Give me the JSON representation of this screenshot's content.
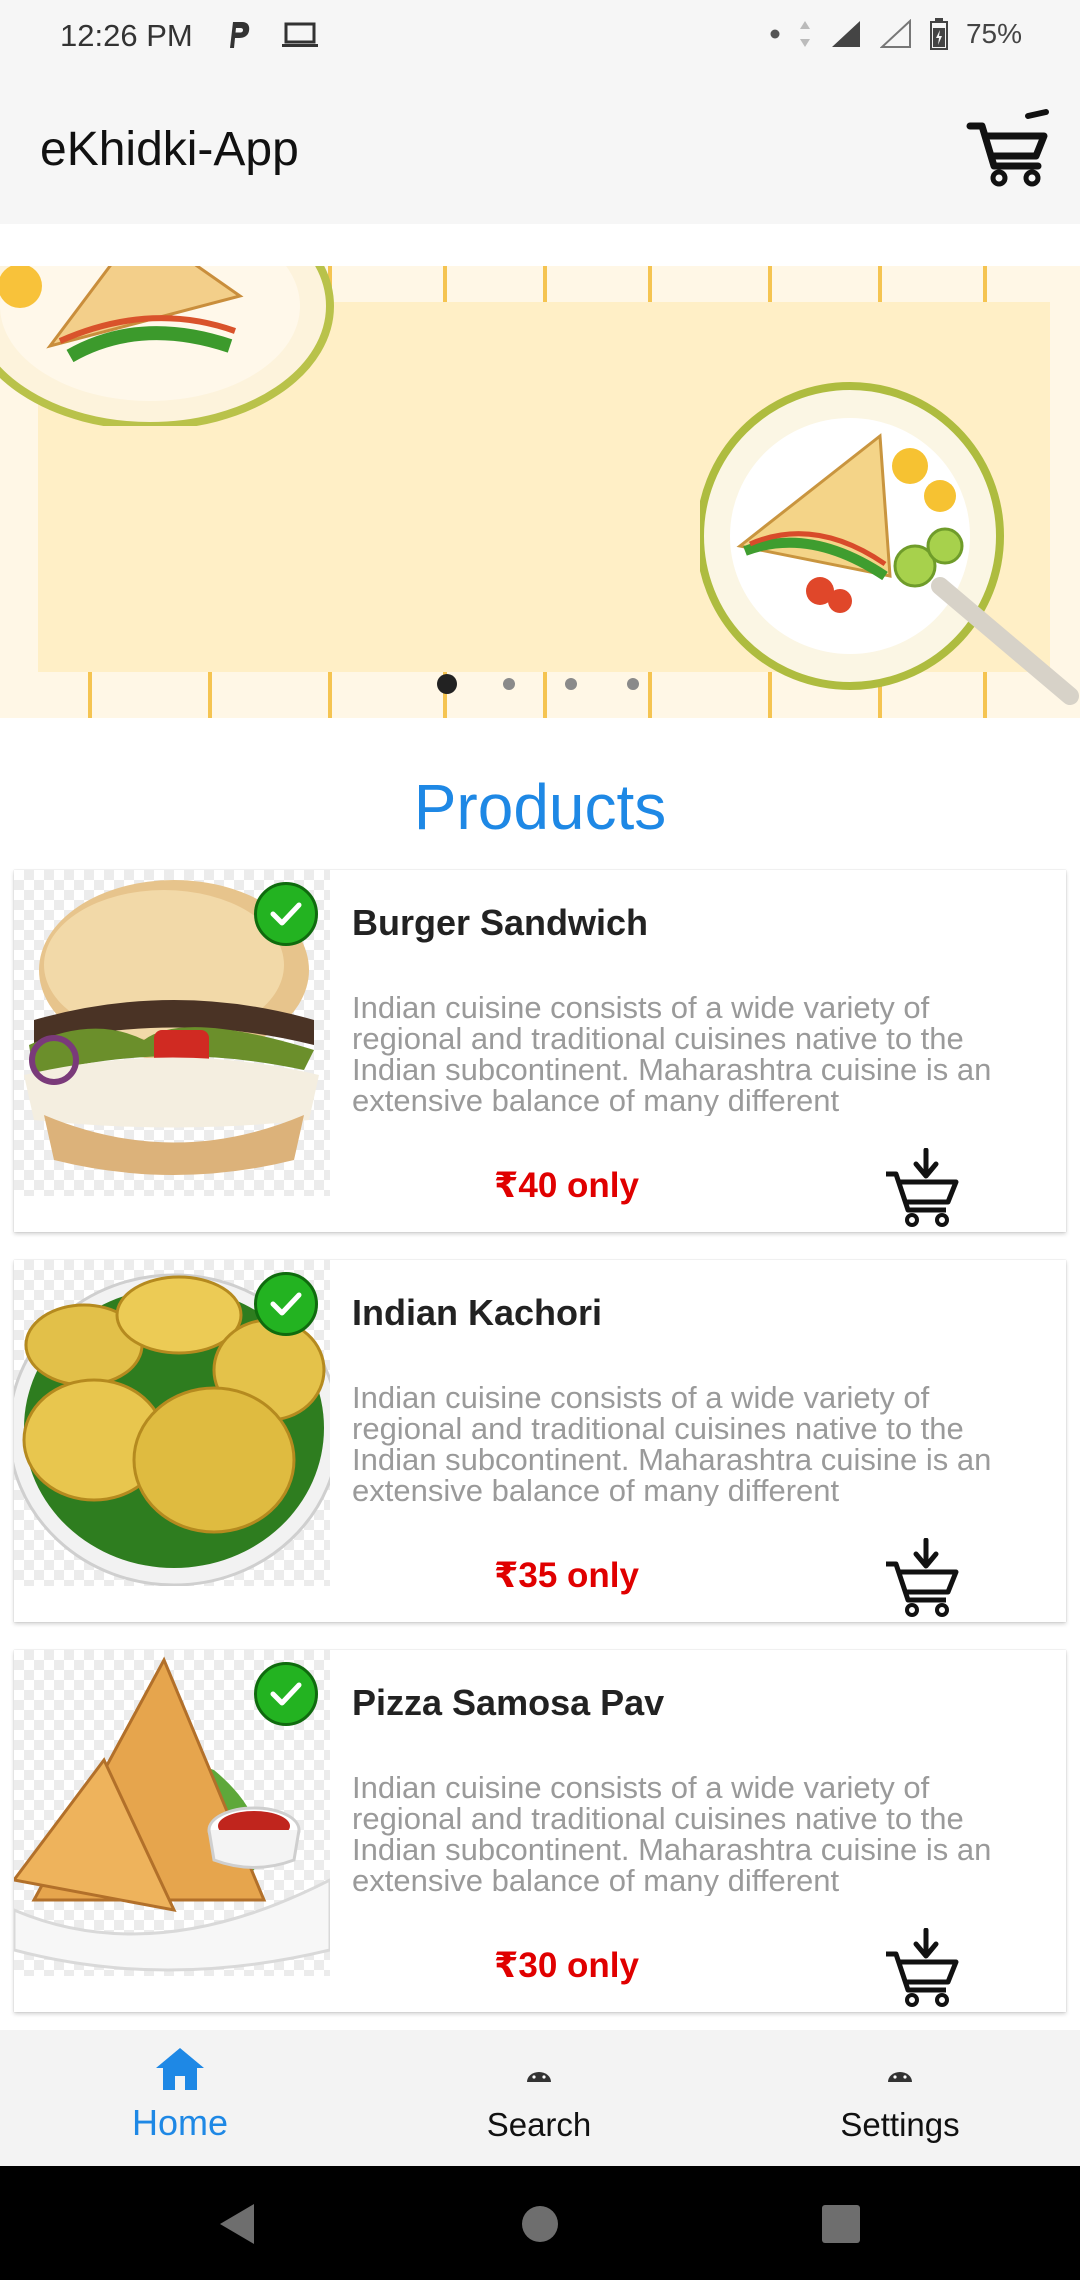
{
  "status_bar": {
    "time": "12:26 PM",
    "battery": "75%",
    "left_icons": [
      "parking-icon",
      "laptop-icon"
    ],
    "right_icons": [
      "dot-icon",
      "data-arrows-icon",
      "signal-icon",
      "signal-empty-icon",
      "battery-icon"
    ]
  },
  "app_bar": {
    "title": "eKhidki-App",
    "cart_icon": "shopping-cart-icon"
  },
  "banner": {
    "slide_count": 4,
    "active_slide": 1
  },
  "section": {
    "title": "Products"
  },
  "products": [
    {
      "name": "Burger Sandwich",
      "description": "Indian cuisine consists of a wide variety of regional and traditional cuisines native to the Indian subcontinent. Maharashtra cuisine is an extensive balance of many different",
      "price": "₹40 only"
    },
    {
      "name": "Indian Kachori",
      "description": "Indian cuisine consists of a wide variety of regional and traditional cuisines native to the Indian subcontinent. Maharashtra cuisine is an extensive balance of many different",
      "price": "₹35 only"
    },
    {
      "name": "Pizza Samosa Pav",
      "description": "Indian cuisine consists of a wide variety of regional and traditional cuisines native to the Indian subcontinent. Maharashtra cuisine is an extensive balance of many different",
      "price": "₹30 only"
    }
  ],
  "bottom_nav": {
    "items": [
      {
        "label": "Home",
        "icon": "home-icon",
        "active": true
      },
      {
        "label": "Search",
        "icon": "android-icon",
        "active": false
      },
      {
        "label": "Settings",
        "icon": "android-icon",
        "active": false
      }
    ]
  },
  "colors": {
    "accent": "#1e88e5",
    "price": "#e00000",
    "check": "#23b321"
  }
}
